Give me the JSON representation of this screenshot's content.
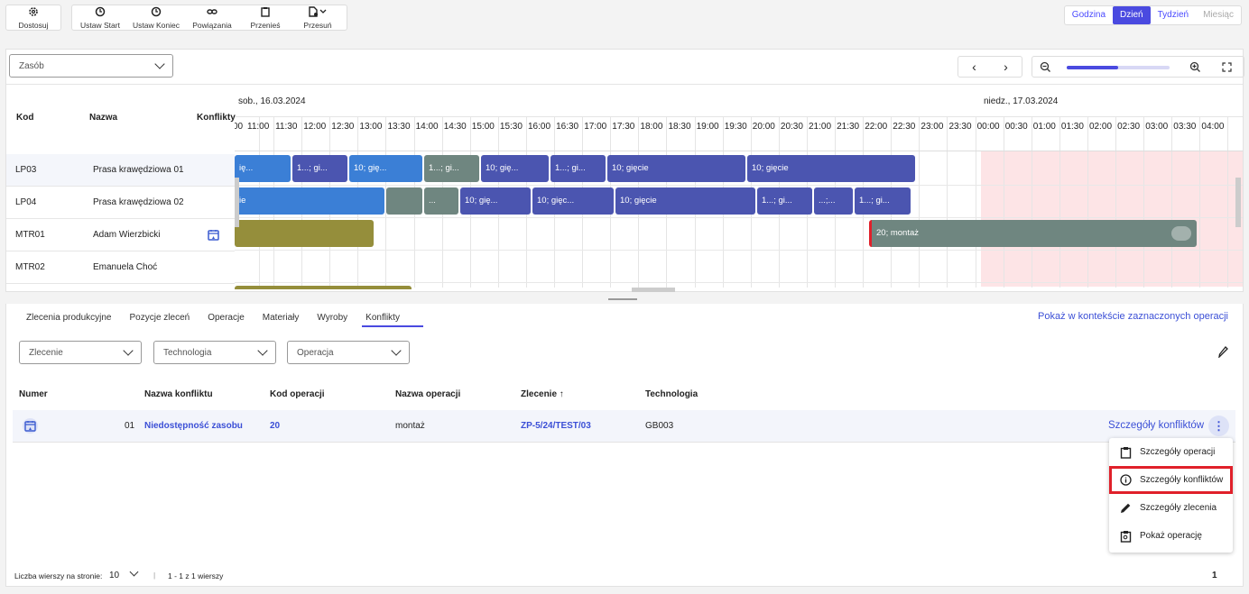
{
  "toolbar": {
    "customize": "Dostosuj",
    "set_start": "Ustaw Start",
    "set_end": "Ustaw Koniec",
    "links": "Powiązania",
    "move": "Przenieś",
    "shift": "Przesuń"
  },
  "view": {
    "hour": "Godzina",
    "day": "Dzień",
    "week": "Tydzień",
    "month": "Miesiąc",
    "active": "Dzień"
  },
  "resource_select": {
    "placeholder": "Zasób"
  },
  "zoom": {
    "level": 0.5
  },
  "gantt": {
    "columns": {
      "code": "Kod",
      "name": "Nazwa",
      "conflicts": "Konflikty"
    },
    "dates": [
      "sob., 16.03.2024",
      "niedz., 17.03.2024"
    ],
    "times": [
      "00",
      "11:00",
      "11:30",
      "12:00",
      "12:30",
      "13:00",
      "13:30",
      "14:00",
      "14:30",
      "15:00",
      "15:30",
      "16:00",
      "16:30",
      "17:00",
      "17:30",
      "18:00",
      "18:30",
      "19:00",
      "19:30",
      "20:00",
      "20:30",
      "21:00",
      "21:30",
      "22:00",
      "22:30",
      "23:00",
      "23:30",
      "00:00",
      "00:30",
      "01:00",
      "01:30",
      "02:00",
      "02:30",
      "03:00",
      "03:30",
      "04:00"
    ],
    "rows": [
      {
        "code": "LP03",
        "name": "Prasa krawędziowa 01",
        "conflict": false
      },
      {
        "code": "LP04",
        "name": "Prasa krawędziowa 02",
        "conflict": false
      },
      {
        "code": "MTR01",
        "name": "Adam Wierzbicki",
        "conflict": true
      },
      {
        "code": "MTR02",
        "name": "Emanuela Choć",
        "conflict": false
      }
    ],
    "bars_row1": [
      "ię...",
      "1...; gi...",
      "10; gię...",
      "1...; gi...",
      "10; gię...",
      "1...; gi...",
      "10; gięcie",
      "10; gięcie"
    ],
    "bars_row2": [
      "ie",
      "",
      "...",
      "10; gię...",
      "10; gięc...",
      "10; gięcie",
      "1...; gi...",
      "...;...",
      "1...; gi..."
    ],
    "bars_row3": [
      "",
      "20; montaż"
    ]
  },
  "tabs": [
    "Zlecenia produkcyjne",
    "Pozycje zleceń",
    "Operacje",
    "Materiały",
    "Wyroby",
    "Konflikty"
  ],
  "active_tab": "Konflikty",
  "context_link": "Pokaż w kontekście zaznaczonych operacji",
  "filters": {
    "order": "Zlecenie",
    "technology": "Technologia",
    "operation": "Operacja"
  },
  "table": {
    "headers": [
      "Numer",
      "Nazwa konfliktu",
      "Kod operacji",
      "Nazwa operacji",
      "Zlecenie ↑",
      "Technologia"
    ],
    "row": {
      "number": "01",
      "conflict_name": "Niedostępność zasobu",
      "op_code": "20",
      "op_name": "montaż",
      "order": "ZP-5/24/TEST/03",
      "technology": "GB003",
      "action": "Szczegóły konfliktów"
    }
  },
  "context_menu": [
    "Szczegóły operacji",
    "Szczegóły konfliktów",
    "Szczegóły zlecenia",
    "Pokaż operację"
  ],
  "footer": {
    "rows_per_page_label": "Liczba wierszy na stronie:",
    "rows_per_page": "10",
    "range": "1 - 1 z 1 wierszy",
    "page": "1"
  },
  "colors": {
    "accent": "#4a4ae0",
    "highlight_border": "#e0202a",
    "weekend": "#fde4e6"
  }
}
